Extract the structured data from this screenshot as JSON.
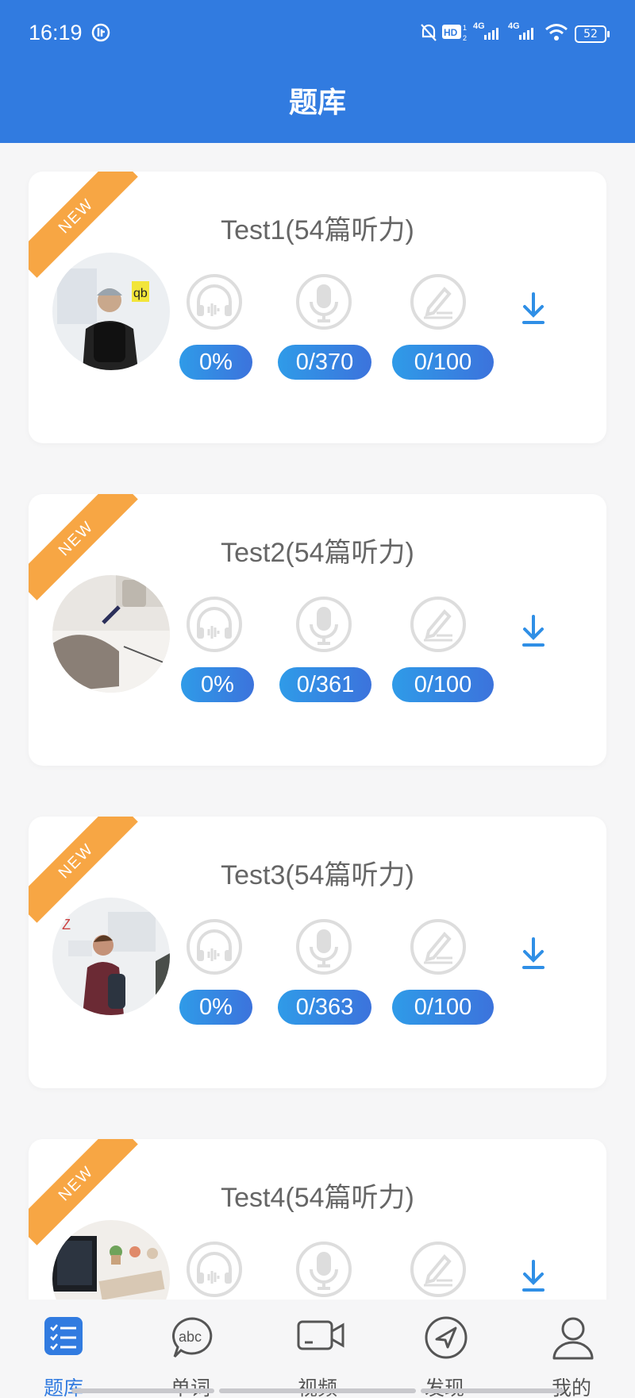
{
  "status_bar": {
    "time": "16:19",
    "battery": "52"
  },
  "header": {
    "title": "题库"
  },
  "cards": [
    {
      "title": "Test1(54篇听力)",
      "badge": "NEW",
      "listen": "0%",
      "speak": "0/370",
      "write": "0/100"
    },
    {
      "title": "Test2(54篇听力)",
      "badge": "NEW",
      "listen": "0%",
      "speak": "0/361",
      "write": "0/100"
    },
    {
      "title": "Test3(54篇听力)",
      "badge": "NEW",
      "listen": "0%",
      "speak": "0/363",
      "write": "0/100"
    },
    {
      "title": "Test4(54篇听力)",
      "badge": "NEW",
      "listen": "",
      "speak": "",
      "write": ""
    }
  ],
  "tabs": [
    {
      "label": "题库",
      "icon": "list-check-icon",
      "active": true
    },
    {
      "label": "单词",
      "icon": "abc-bubble-icon"
    },
    {
      "label": "视频",
      "icon": "video-camera-icon"
    },
    {
      "label": "发现",
      "icon": "compass-icon"
    },
    {
      "label": "我的",
      "icon": "person-icon"
    }
  ],
  "colors": {
    "accent": "#317be0",
    "ribbon": "#f7a644",
    "pill_start": "#2f9be8",
    "pill_end": "#3c73dc"
  }
}
